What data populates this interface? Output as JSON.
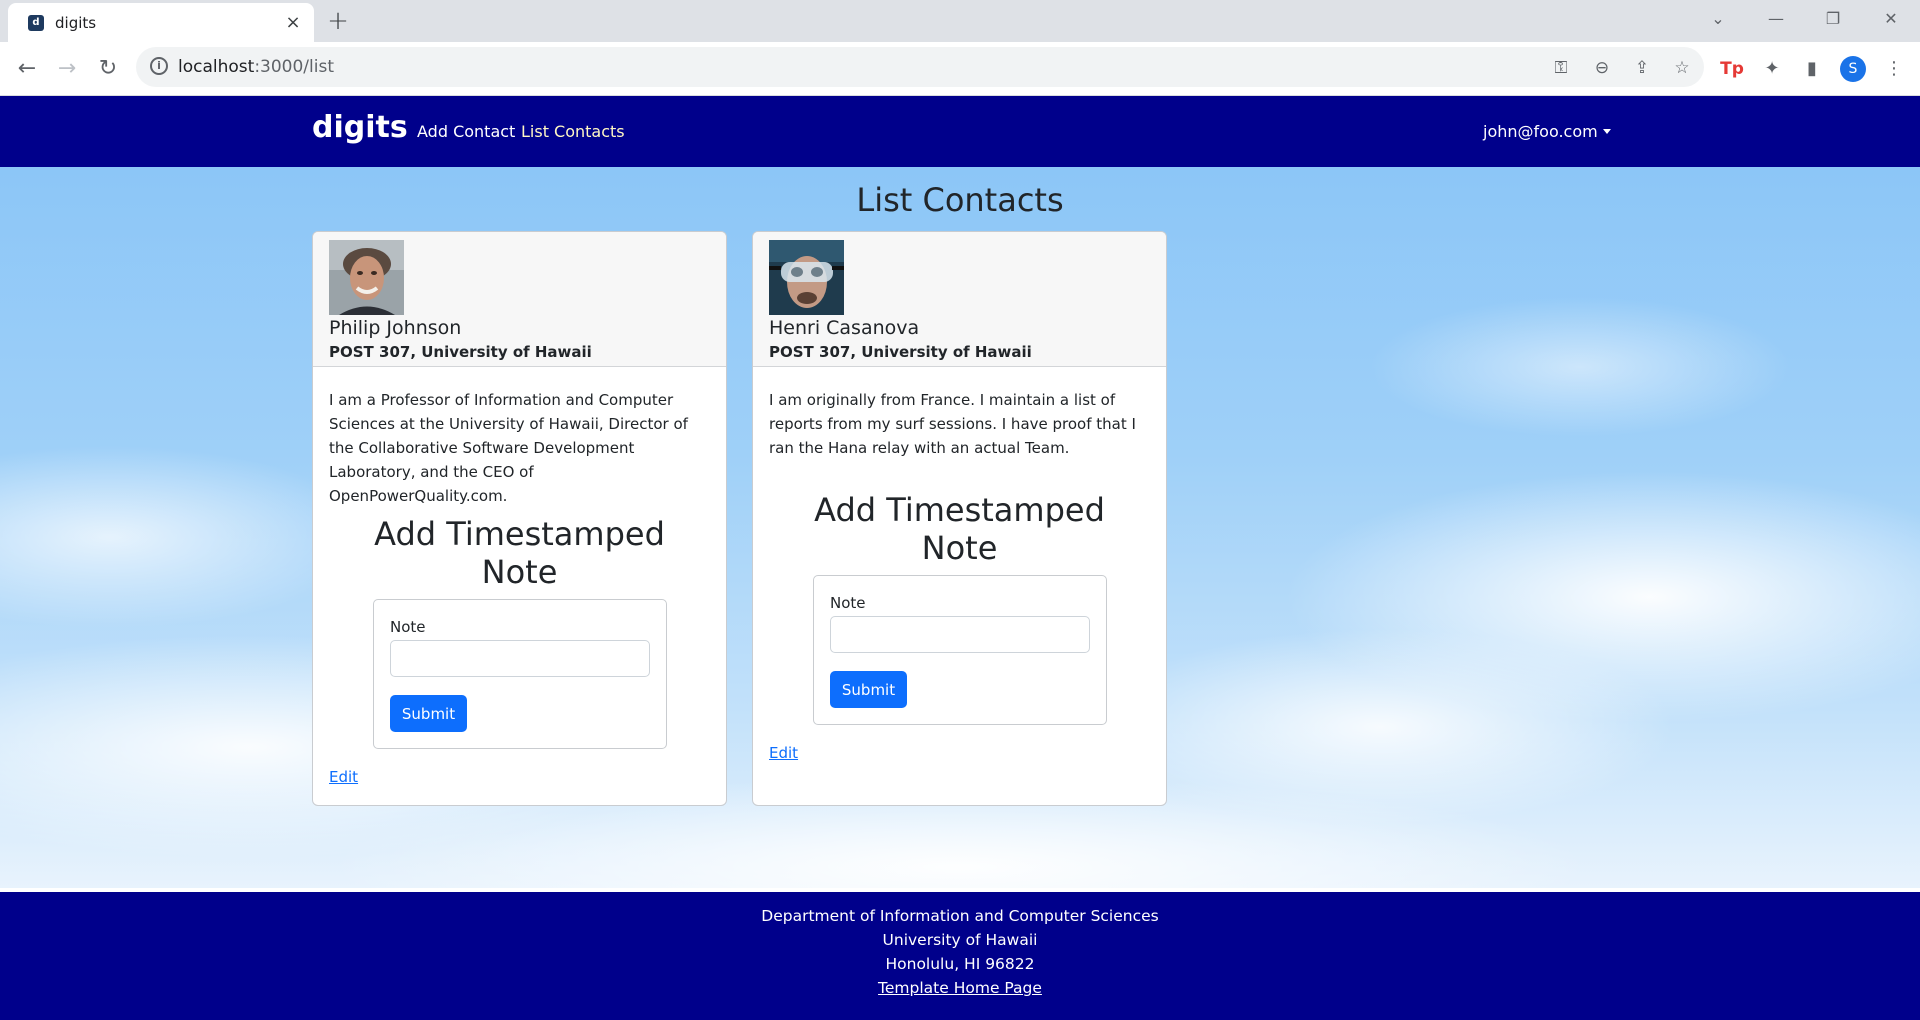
{
  "browser": {
    "tab_title": "digits",
    "favicon_letter": "d",
    "new_tab_symbol": "+",
    "url_host": "localhost",
    "url_path": ":3000/list",
    "profile_initial": "S",
    "extension_label": "Tp"
  },
  "navbar": {
    "brand": "digits",
    "links": [
      {
        "label": "Add Contact"
      },
      {
        "label": "List Contacts"
      }
    ],
    "user": "john@foo.com",
    "colors": {
      "background": "#00008b",
      "active_link": "#fff7c4"
    }
  },
  "main": {
    "title": "List Contacts",
    "contacts": [
      {
        "name": "Philip Johnson",
        "address": "POST 307, University of Hawaii",
        "description": "I am a Professor of Information and Computer Sciences at the University of Hawaii, Director of the Collaborative Software Development Laboratory, and the CEO of OpenPowerQuality.com.",
        "note_title": "Add Timestamped Note",
        "note_label": "Note",
        "note_value": "",
        "submit_label": "Submit",
        "edit_label": "Edit"
      },
      {
        "name": "Henri Casanova",
        "address": "POST 307, University of Hawaii",
        "description": "I am originally from France. I maintain a list of reports from my surf sessions. I have proof that I ran the Hana relay with an actual Team.",
        "note_title": "Add Timestamped Note",
        "note_label": "Note",
        "note_value": "",
        "submit_label": "Submit",
        "edit_label": "Edit"
      }
    ]
  },
  "footer": {
    "line1": "Department of Information and Computer Sciences",
    "line2": "University of Hawaii",
    "line3": "Honolulu, HI 96822",
    "link": "Template Home Page"
  },
  "colors": {
    "primary_button": "#0d6efd"
  }
}
